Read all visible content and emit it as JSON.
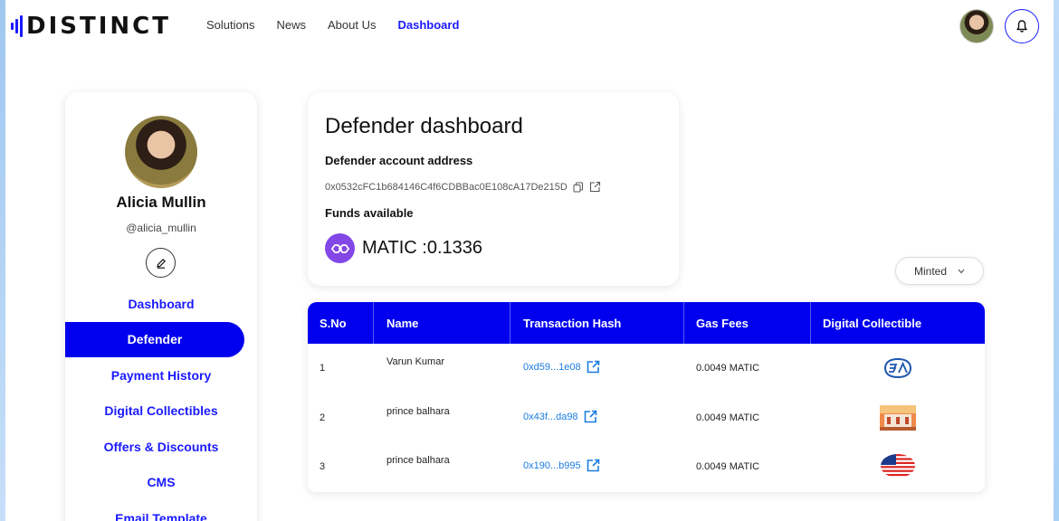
{
  "header": {
    "logo_text": "DISTINCT",
    "nav": [
      {
        "label": "Solutions",
        "active": false
      },
      {
        "label": "News",
        "active": false
      },
      {
        "label": "About Us",
        "active": false
      },
      {
        "label": "Dashboard",
        "active": true
      }
    ]
  },
  "sidebar": {
    "name": "Alicia Mullin",
    "handle": "@alicia_mullin",
    "items": [
      {
        "label": "Dashboard",
        "active": false
      },
      {
        "label": "Defender",
        "active": true
      },
      {
        "label": "Payment History",
        "active": false
      },
      {
        "label": "Digital Collectibles",
        "active": false
      },
      {
        "label": "Offers & Discounts",
        "active": false
      },
      {
        "label": "CMS",
        "active": false
      },
      {
        "label": "Email Template",
        "active": false
      }
    ]
  },
  "dashboard": {
    "title": "Defender dashboard",
    "address_label": "Defender account address",
    "address": "0x0532cFC1b684146C4f6CDBBac0E108cA17De215D",
    "funds_label": "Funds available",
    "balance": "MATIC :0.1336"
  },
  "filter": {
    "selected": "Minted"
  },
  "table": {
    "headers": [
      "S.No",
      "Name",
      "Transaction Hash",
      "Gas Fees",
      "Digital Collectible"
    ],
    "rows": [
      {
        "sno": "1",
        "name": "Varun Kumar",
        "hash": "0xd59...1e08",
        "gas": "0.0049 MATIC",
        "collectible_icon": "ba-logo-icon"
      },
      {
        "sno": "2",
        "name": "prince balhara",
        "hash": "0x43f...da98",
        "gas": "0.0049 MATIC",
        "collectible_icon": "building-photo-icon"
      },
      {
        "sno": "3",
        "name": "prince balhara",
        "hash": "0x190...b995",
        "gas": "0.0049 MATIC",
        "collectible_icon": "us-flag-icon"
      }
    ]
  },
  "colors": {
    "accent": "#0000ee",
    "link": "#1a7de0",
    "matic": "#8247e5"
  }
}
